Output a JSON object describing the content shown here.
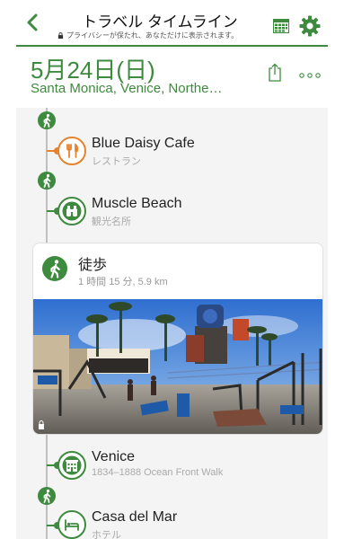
{
  "header": {
    "title": "トラベル タイムライン",
    "privacy_note": "プライバシーが保たれ、あなただけに表示されます。"
  },
  "day": {
    "date": "5月24日(日)",
    "places_summary": "Santa Monica, Venice, Northe…"
  },
  "timeline": [
    {
      "kind": "place",
      "name": "Blue Daisy Cafe",
      "category": "レストラン",
      "icon": "fork-knife-icon",
      "color": "#e8822e"
    },
    {
      "kind": "place",
      "name": "Muscle Beach",
      "category": "観光名所",
      "icon": "binoculars-icon",
      "color": "#3e8a3e"
    },
    {
      "kind": "walk",
      "title": "徒歩",
      "detail": "1 時間 15 分, 5.9 km"
    },
    {
      "kind": "place",
      "name": "Venice",
      "address": "1834–1888 Ocean Front Walk",
      "icon": "building-icon",
      "color": "#3e8a3e"
    },
    {
      "kind": "place",
      "name": "Casa del Mar",
      "category": "ホテル",
      "icon": "bed-icon",
      "color": "#3e8a3e"
    }
  ],
  "colors": {
    "accent": "#3e8a3e",
    "restaurant": "#e8822e",
    "line": "#bfbfbf"
  }
}
